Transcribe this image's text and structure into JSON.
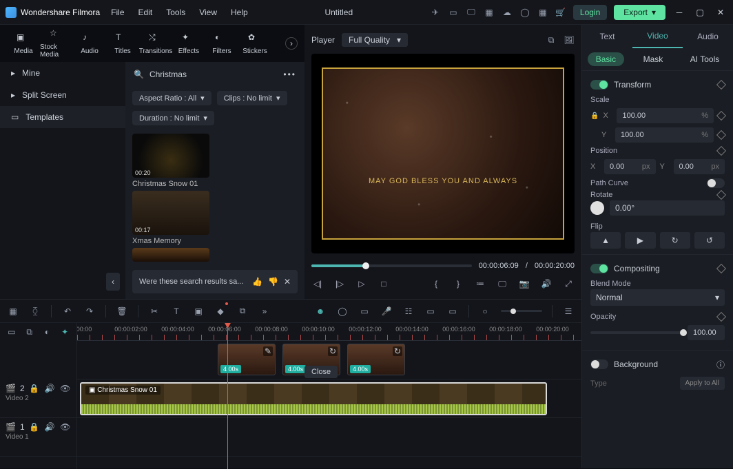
{
  "app": {
    "name": "Wondershare Filmora",
    "title": "Untitled"
  },
  "menu": [
    "File",
    "Edit",
    "Tools",
    "View",
    "Help"
  ],
  "titlebar": {
    "login": "Login",
    "export": "Export"
  },
  "tabs": {
    "items": [
      {
        "label": "Media"
      },
      {
        "label": "Stock Media"
      },
      {
        "label": "Audio"
      },
      {
        "label": "Titles"
      },
      {
        "label": "Transitions"
      },
      {
        "label": "Effects"
      },
      {
        "label": "Filters"
      },
      {
        "label": "Stickers"
      }
    ]
  },
  "sidebar": {
    "items": [
      {
        "label": "Mine"
      },
      {
        "label": "Split Screen"
      },
      {
        "label": "Templates"
      }
    ]
  },
  "browse": {
    "search": "Christmas",
    "filters": {
      "aspect": "Aspect Ratio : All",
      "clips": "Clips : No limit",
      "duration": "Duration : No limit"
    },
    "thumbs": [
      {
        "time": "00:20",
        "label": "Christmas Snow 01"
      },
      {
        "time": "00:17",
        "label": "Xmas Memory"
      }
    ],
    "feedback": "Were these search results sa..."
  },
  "player": {
    "label": "Player",
    "quality": "Full Quality",
    "preview_text": "MAY GOD BLESS YOU AND ALWAYS",
    "time_current": "00:00:06:09",
    "time_total": "00:00:20:00",
    "sep": "/"
  },
  "inspector": {
    "tabs": [
      "Text",
      "Video",
      "Audio"
    ],
    "subtabs": [
      "Basic",
      "Mask",
      "AI Tools"
    ],
    "transform": "Transform",
    "scale": "Scale",
    "x": "X",
    "y": "Y",
    "scale_x": "100.00",
    "scale_y": "100.00",
    "pct": "%",
    "position": "Position",
    "pos_x": "0.00",
    "pos_y": "0.00",
    "px": "px",
    "path_curve": "Path Curve",
    "rotate": "Rotate",
    "rotate_val": "0.00°",
    "flip": "Flip",
    "compositing": "Compositing",
    "blend": "Blend Mode",
    "blend_val": "Normal",
    "opacity": "Opacity",
    "opacity_val": "100.00",
    "background": "Background",
    "type": "Type",
    "apply_all": "Apply to All"
  },
  "timeline": {
    "ticks": [
      "00:00",
      "00:00:02:00",
      "00:00:04:00",
      "00:00:06:00",
      "00:00:08:00",
      "00:00:10:00",
      "00:00:12:00",
      "00:00:14:00",
      "00:00:16:00",
      "00:00:18:00",
      "00:00:20:00"
    ],
    "clip_badge": "4.00s",
    "bigclip_label": "Christmas Snow 01",
    "close": "Close",
    "tracks": [
      {
        "name": "Video 2",
        "badge": "2"
      },
      {
        "name": "Video 1",
        "badge": "1"
      }
    ]
  }
}
